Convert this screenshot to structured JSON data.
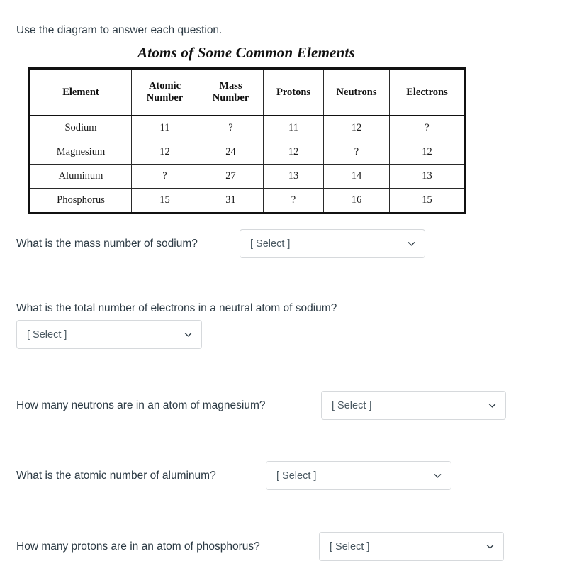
{
  "intro": "Use the diagram to answer each question.",
  "diagram": {
    "title": "Atoms of Some Common Elements",
    "columns": [
      {
        "line1": "Element",
        "line2": ""
      },
      {
        "line1": "Atomic",
        "line2": "Number"
      },
      {
        "line1": "Mass",
        "line2": "Number"
      },
      {
        "line1": "Protons",
        "line2": ""
      },
      {
        "line1": "Neutrons",
        "line2": ""
      },
      {
        "line1": "Electrons",
        "line2": ""
      }
    ],
    "rows": [
      {
        "element": "Sodium",
        "atomic_number": "11",
        "mass_number": "?",
        "protons": "11",
        "neutrons": "12",
        "electrons": "?"
      },
      {
        "element": "Magnesium",
        "atomic_number": "12",
        "mass_number": "24",
        "protons": "12",
        "neutrons": "?",
        "electrons": "12"
      },
      {
        "element": "Aluminum",
        "atomic_number": "?",
        "mass_number": "27",
        "protons": "13",
        "neutrons": "14",
        "electrons": "13"
      },
      {
        "element": "Phosphorus",
        "atomic_number": "15",
        "mass_number": "31",
        "protons": "?",
        "neutrons": "16",
        "electrons": "15"
      }
    ]
  },
  "questions": [
    {
      "text": "What is the mass number of sodium?",
      "select": {
        "value": "[ Select ]",
        "icon": "chevron-down-icon"
      }
    },
    {
      "text": "What is the total number of electrons in a neutral atom of sodium?",
      "select": {
        "value": "[ Select ]",
        "icon": "chevron-down-icon"
      }
    },
    {
      "text": "How many neutrons are in an atom of magnesium?",
      "select": {
        "value": "[ Select ]",
        "icon": "chevron-down-icon"
      }
    },
    {
      "text": "What is the atomic number of aluminum?",
      "select": {
        "value": "[ Select ]",
        "icon": "chevron-down-icon"
      }
    },
    {
      "text": "How many protons are in an atom of phosphorus?",
      "select": {
        "value": "[ Select ]",
        "icon": "chevron-down-icon"
      }
    }
  ],
  "colors": {
    "text": "#2d3b45",
    "select_border": "#d6d9dc",
    "select_text": "#4b5962",
    "table_border": "#111111",
    "background": "#ffffff"
  }
}
